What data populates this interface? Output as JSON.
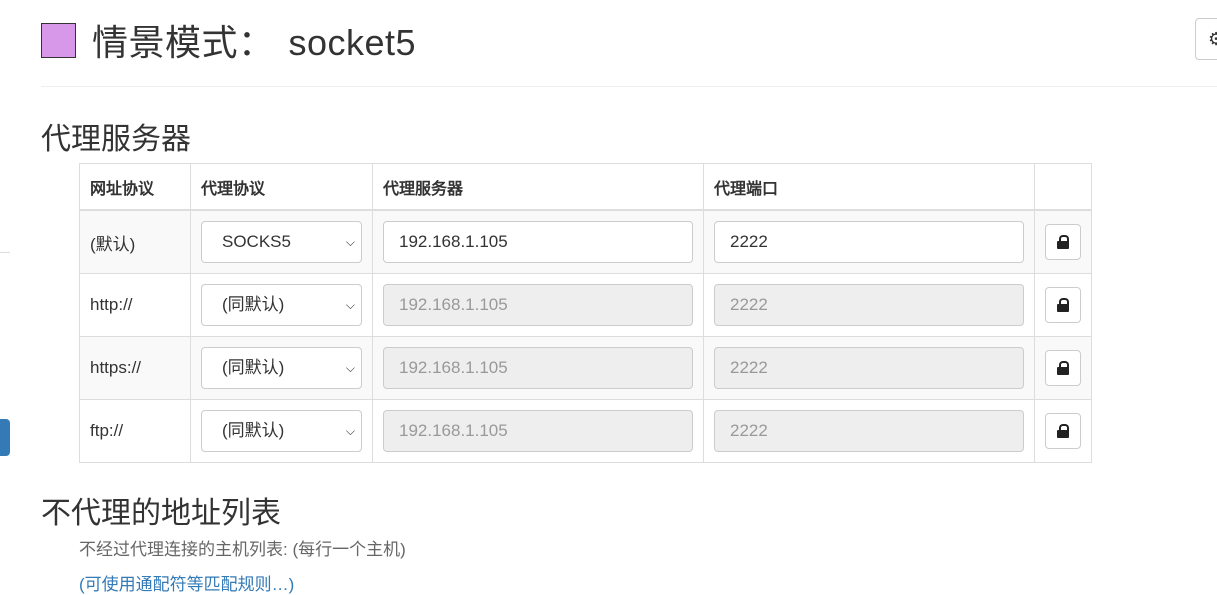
{
  "header": {
    "profile_label": "情景模式：",
    "profile_name": "socket5",
    "swatch_color": "#d898ea",
    "top_right_icon": "gear-icon",
    "top_right_glyph": "⚙"
  },
  "proxy": {
    "section_title": "代理服务器",
    "columns": [
      "网址协议",
      "代理协议",
      "代理服务器",
      "代理端口"
    ],
    "rows": [
      {
        "scheme": "(默认)",
        "protocol": "SOCKS5",
        "server": "192.168.1.105",
        "port": "2222",
        "disabled": false
      },
      {
        "scheme": "http://",
        "protocol": "(同默认)",
        "server": "192.168.1.105",
        "port": "2222",
        "disabled": true
      },
      {
        "scheme": "https://",
        "protocol": "(同默认)",
        "server": "192.168.1.105",
        "port": "2222",
        "disabled": true
      },
      {
        "scheme": "ftp://",
        "protocol": "(同默认)",
        "server": "192.168.1.105",
        "port": "2222",
        "disabled": true
      }
    ],
    "row_icon": "lock-icon"
  },
  "bypass": {
    "section_title": "不代理的地址列表",
    "help_text": "不经过代理连接的主机列表: (每行一个主机)",
    "help_link": "(可使用通配符等匹配规则…)"
  }
}
